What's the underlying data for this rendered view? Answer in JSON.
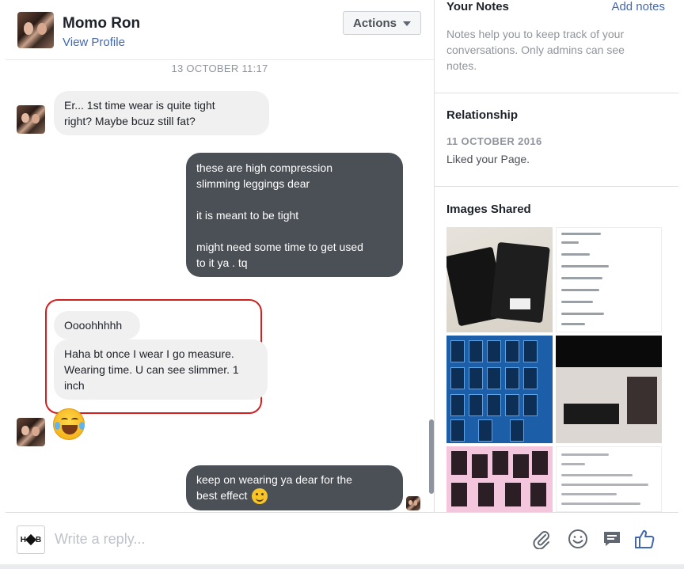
{
  "chat": {
    "contact_name": "Momo Ron",
    "view_profile": "View Profile",
    "actions_label": "Actions",
    "timestamp": "13 OCTOBER 11:17",
    "messages": [
      {
        "from": "contact",
        "lines": [
          "Er... 1st time wear is quite tight",
          "right? Maybe bcuz still fat?"
        ]
      },
      {
        "from": "page",
        "lines": [
          "these are high compression",
          "slimming leggings dear",
          "",
          "it is meant to be tight",
          "",
          "might need some time to get used",
          "to it ya . tq"
        ]
      },
      {
        "from": "contact",
        "lines": [
          "Oooohhhhh"
        ]
      },
      {
        "from": "contact",
        "lines": [
          "Haha bt once I wear I go measure.",
          "Wearing time. U can see slimmer. 1",
          "inch"
        ]
      },
      {
        "from": "contact",
        "emoji": "face-with-tears-of-joy"
      },
      {
        "from": "page",
        "lines": [
          "keep on wearing ya dear for the",
          "best effect"
        ],
        "emoji": "slightly-smiling-face"
      }
    ]
  },
  "composer": {
    "placeholder": "Write a reply...",
    "page_logo_text_left": "H",
    "page_logo_text_right": "B",
    "icons": [
      "paperclip-icon",
      "emoji-icon",
      "saved-replies-icon",
      "like-icon"
    ]
  },
  "panel": {
    "notes_title": "Your Notes",
    "add_notes": "Add notes",
    "notes_help": "Notes help you to keep track of your conversations. Only admins can see notes.",
    "relationship_title": "Relationship",
    "relationship_date": "11 OCTOBER 2016",
    "relationship_text": "Liked your Page.",
    "images_title": "Images Shared"
  },
  "colors": {
    "link_blue": "#4267b2",
    "outgoing_bubble": "#4b4f56",
    "incoming_bubble": "#f1f0f0",
    "highlight_ring": "#d0201f",
    "like_blue": "#4267b2"
  }
}
